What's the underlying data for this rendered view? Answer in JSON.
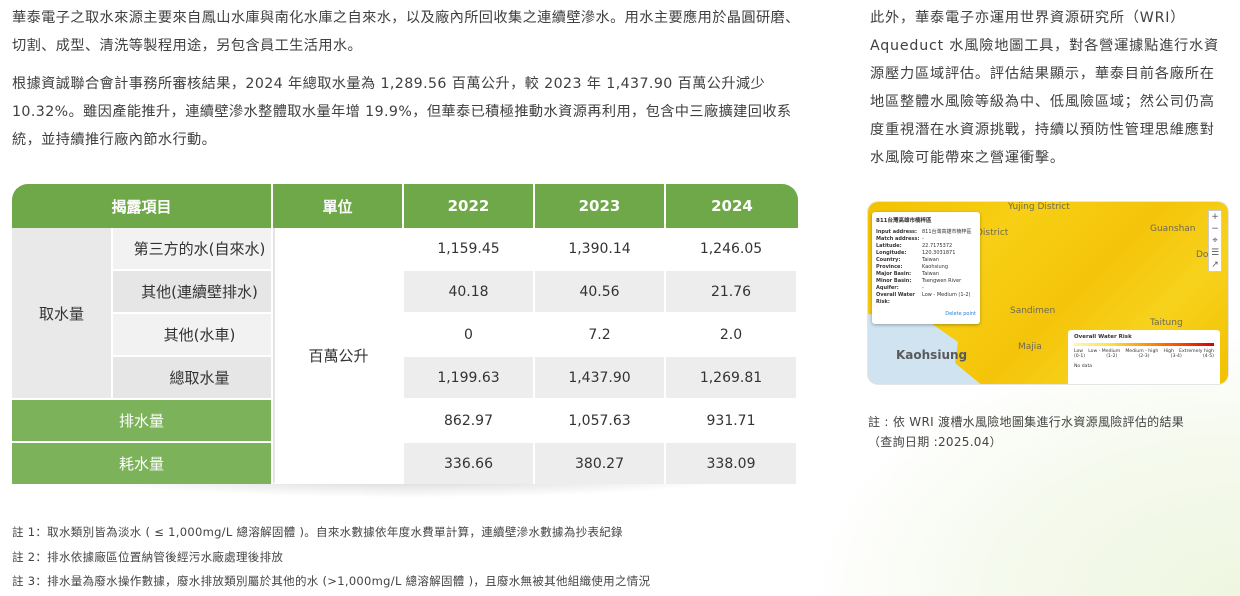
{
  "intro": {
    "paragraph1": "華泰電子之取水來源主要來自鳳山水庫與南化水庫之自來水，以及廠內所回收集之連續壁滲水。用水主要應用於晶圓研磨、切割、成型、清洗等製程用途，另包含員工生活用水。",
    "paragraph2": "根據資誠聯合會計事務所審核結果，2024 年總取水量為 1,289.56 百萬公升，較 2023 年 1,437.90 百萬公升減少 10.32%。雖因產能推升，連續壁滲水整體取水量年增 19.9%，但華泰已積極推動水資源再利用，包含中三廠擴建回收系統，並持續推行廠內節水行動。"
  },
  "right_text": "此外，華泰電子亦運用世界資源研究所（WRI）Aqueduct 水風險地圖工具，對各營運據點進行水資源壓力區域評估。評估結果顯示，華泰目前各廠所在地區整體水風險等級為中、低風險區域；然公司仍高度重視潛在水資源挑戰，持續以預防性管理思維應對水風險可能帶來之營運衝擊。",
  "table": {
    "headers": [
      "揭露項目",
      "單位",
      "2022",
      "2023",
      "2024"
    ],
    "group_label": "取水量",
    "unit": "百萬公升",
    "rows": [
      {
        "label": "第三方的水(自來水)",
        "values": [
          "1,159.45",
          "1,390.14",
          "1,246.05"
        ]
      },
      {
        "label": "其他(連續壁排水)",
        "values": [
          "40.18",
          "40.56",
          "21.76"
        ]
      },
      {
        "label": "其他(水車)",
        "values": [
          "0",
          "7.2",
          "2.0"
        ]
      },
      {
        "label": "總取水量",
        "values": [
          "1,199.63",
          "1,437.90",
          "1,269.81"
        ]
      }
    ],
    "discharge": {
      "label": "排水量",
      "values": [
        "862.97",
        "1,057.63",
        "931.71"
      ]
    },
    "consumption": {
      "label": "耗水量",
      "values": [
        "336.66",
        "380.27",
        "338.09"
      ]
    }
  },
  "notes": [
    "註 1：取水類別皆為淡水 ( ≤ 1,000mg/L 總溶解固體 )。自來水數據依年度水費單計算，連續壁滲水數據為抄表紀錄",
    "註 2：排水依據廠區位置納管後經污水廠處理後排放",
    "註 3：排水量為廢水操作數據，廢水排放類別屬於其他的水 (>1,000mg/L 總溶解固體 )，且廢水無被其他組織使用之情況"
  ],
  "map": {
    "labels": {
      "yujing": "Yujing District",
      "district": "District",
      "guanshan": "Guanshan",
      "dor": "Dor",
      "sandimen": "Sandimen",
      "taitung": "Taitung",
      "majia": "Majia",
      "kaohsiung": "Kaohsiung"
    },
    "popup": {
      "title": "811台灣高雄市楠梓區",
      "fields": [
        {
          "k": "Input address:",
          "v": "811台灣高雄市楠梓區"
        },
        {
          "k": "Match address:",
          "v": "-"
        },
        {
          "k": "Latitude:",
          "v": "22.7175372"
        },
        {
          "k": "Longitude:",
          "v": "120.3031871"
        },
        {
          "k": "Country:",
          "v": "Taiwan"
        },
        {
          "k": "Province:",
          "v": "Kaohsiung"
        },
        {
          "k": "Major Basin:",
          "v": "Taiwan"
        },
        {
          "k": "Minor Basin:",
          "v": "Tsengwen River"
        },
        {
          "k": "Aquifer:",
          "v": "-"
        },
        {
          "k": "Overall Water Risk:",
          "v": "Low - Medium (1-2)"
        }
      ],
      "delete": "Delete point"
    },
    "legend": {
      "title": "Overall Water Risk",
      "levels": [
        "Low",
        "Low - Medium",
        "Medium - high",
        "High",
        "Extremely high"
      ],
      "ranges": [
        "(0-1)",
        "(1-2)",
        "(2-3)",
        "(3-4)",
        "(4-5)"
      ],
      "nodata": "No data"
    }
  },
  "caption": {
    "line1": "註 : 依 WRI 渡槽水風險地圖集進行水資源風險評估的結果",
    "line2": "（查詢日期 :2025.04）"
  }
}
